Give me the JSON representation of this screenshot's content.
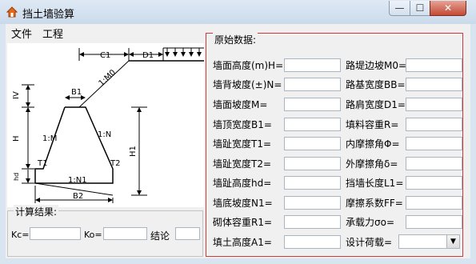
{
  "window": {
    "title": "挡土墙验算",
    "minimize": "—",
    "maximize": "☐",
    "close": "✕"
  },
  "menu": {
    "items": [
      "文件",
      "工程"
    ]
  },
  "diagram": {
    "labels": {
      "c1": "C1",
      "d1": "D1",
      "m0": "1:M0",
      "b1": "B1",
      "iv": "IV",
      "h": "H",
      "m": "1:M",
      "n": "1:N",
      "h1": "H1",
      "t1": "T1",
      "t2": "T2",
      "hd": "hd",
      "n1": "1:N1",
      "b2": "B2"
    }
  },
  "results": {
    "title": "计算结果:",
    "kc_label": "Kc=",
    "ko_label": "Ko=",
    "conclusion_label": "结论",
    "kc_value": "",
    "ko_value": "",
    "conclusion_value": ""
  },
  "data": {
    "title": "原始数据:",
    "left_fields": [
      {
        "label": "墙面高度(m)H=",
        "value": ""
      },
      {
        "label": "墙背坡度(±)N=",
        "value": ""
      },
      {
        "label": "墙面坡度M=",
        "value": ""
      },
      {
        "label": "墙顶宽度B1=",
        "value": ""
      },
      {
        "label": "墙趾宽度T1=",
        "value": ""
      },
      {
        "label": "墙趾宽度T2=",
        "value": ""
      },
      {
        "label": "墙趾高度hd=",
        "value": ""
      },
      {
        "label": "墙底坡度N1=",
        "value": ""
      },
      {
        "label": "砌体容重R1=",
        "value": ""
      },
      {
        "label": "填土高度A1=",
        "value": ""
      }
    ],
    "right_fields": [
      {
        "label": "路堤边坡M0=",
        "value": ""
      },
      {
        "label": "路基宽度BB=",
        "value": ""
      },
      {
        "label": "路肩宽度D1=",
        "value": ""
      },
      {
        "label": "填料容重R=",
        "value": ""
      },
      {
        "label": "内摩擦角Φ=",
        "value": ""
      },
      {
        "label": "外摩擦角δ=",
        "value": ""
      },
      {
        "label": "挡墙长度L1=",
        "value": ""
      },
      {
        "label": "摩擦系数FF=",
        "value": ""
      },
      {
        "label": "承载力σo=",
        "value": ""
      }
    ],
    "design_load": {
      "label": "设计荷载=",
      "selected": ""
    }
  }
}
